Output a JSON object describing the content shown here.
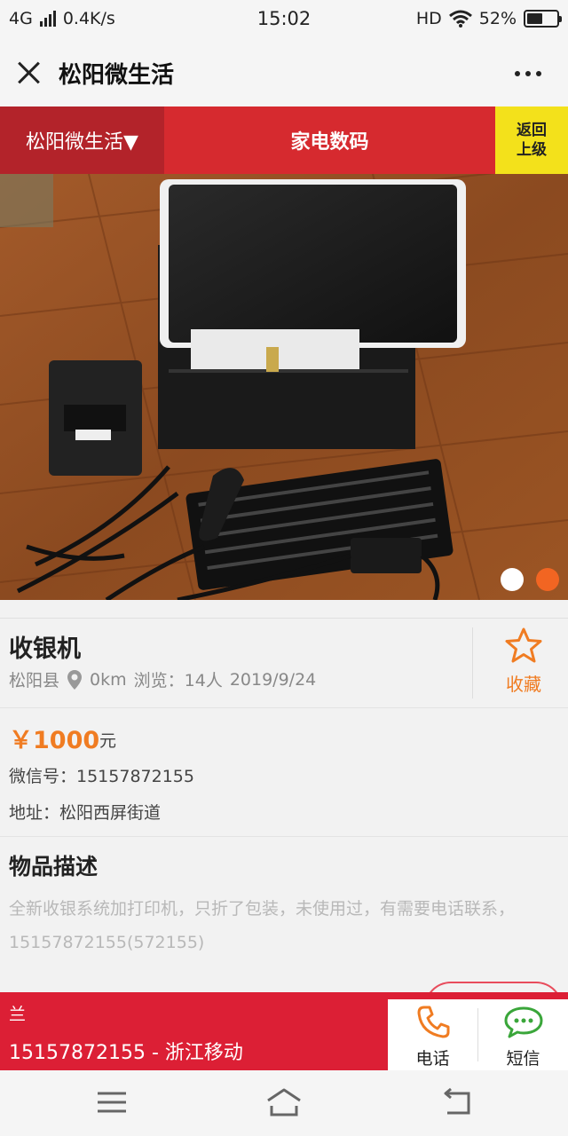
{
  "status_bar": {
    "network": "4G",
    "speed": "0.4K/s",
    "time": "15:02",
    "hd": "HD",
    "battery": "52%",
    "battery_level": 0.52
  },
  "titlebar": {
    "title": "松阳微生活"
  },
  "nav": {
    "city": "松阳微生活▼",
    "category": "家电数码",
    "back_line1": "返回",
    "back_line2": "上级"
  },
  "carousel": {
    "slides": 2,
    "active_slide": 2
  },
  "item": {
    "title": "收银机",
    "location": "松阳县",
    "distance": "0km",
    "views_label": "浏览：",
    "views": "14人",
    "date": "2019/9/24",
    "favorite_label": "收藏"
  },
  "details": {
    "price": "￥1000",
    "price_unit": "元",
    "wechat": "微信号：15157872155",
    "address": "地址：松阳西屏街道"
  },
  "description": {
    "title": "物品描述",
    "text": "全新收银系统加打印机，只折了包装，未使用过，有需要电话联系，15157872155(572155)"
  },
  "contact": {
    "name": "兰",
    "phone": "15157872155 - 浙江移动",
    "call_label": "电话",
    "sms_label": "短信"
  },
  "colors": {
    "accent_red": "#d62a2f",
    "dark_red": "#b3232a",
    "yellow": "#f3e11b",
    "orange": "#f07c22",
    "contact_red": "#dc1f35",
    "sms_green": "#3aa63a"
  }
}
